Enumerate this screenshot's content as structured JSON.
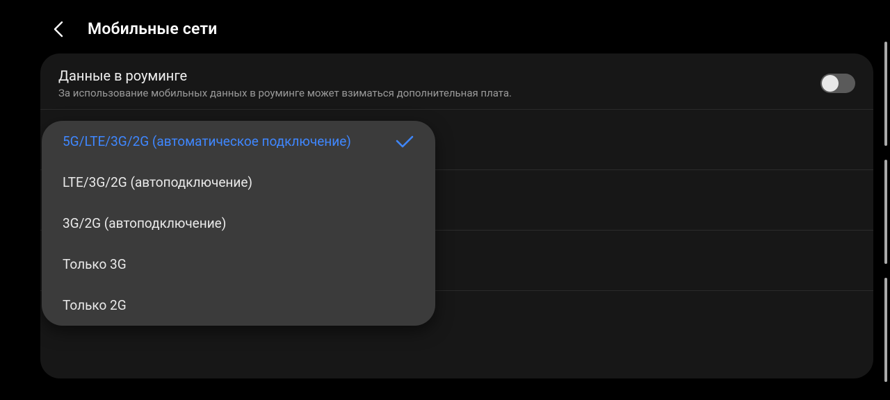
{
  "header": {
    "title": "Мобильные сети"
  },
  "roaming": {
    "title": "Данные в роуминге",
    "subtitle": "За использование мобильных данных в роуминге может взиматься дополнительная плата.",
    "enabled": false
  },
  "background_rows": [
    {
      "title": ""
    },
    {
      "title": ""
    },
    {
      "title": ""
    },
    {
      "title": ""
    }
  ],
  "network_mode_popup": {
    "options": [
      {
        "label": "5G/LTE/3G/2G (автоматическое подключение)",
        "selected": true
      },
      {
        "label": "LTE/3G/2G (автоподключение)",
        "selected": false
      },
      {
        "label": "3G/2G (автоподключение)",
        "selected": false
      },
      {
        "label": "Только 3G",
        "selected": false
      },
      {
        "label": "Только 2G",
        "selected": false
      }
    ]
  },
  "colors": {
    "accent": "#3f87ff"
  }
}
